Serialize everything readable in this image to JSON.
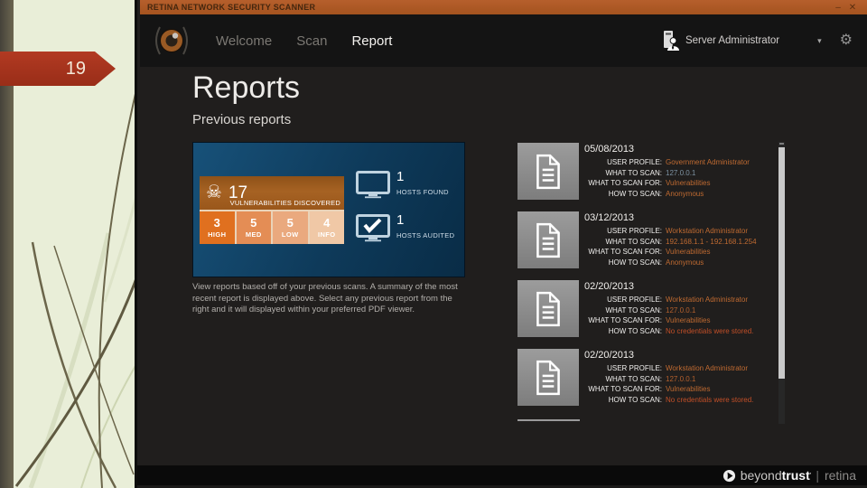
{
  "slide": {
    "number": "19"
  },
  "window": {
    "title": "RETINA NETWORK SECURITY SCANNER",
    "minimize": "–",
    "close": "✕"
  },
  "nav": {
    "tabs": [
      {
        "label": "Welcome",
        "active": false
      },
      {
        "label": "Scan",
        "active": false
      },
      {
        "label": "Report",
        "active": true
      }
    ],
    "user_label": "Server Administrator",
    "caret": "▾",
    "gear": "⚙"
  },
  "page": {
    "title": "Reports",
    "subtitle": "Previous reports",
    "description": "View reports based off of your previous scans.  A summary of the most recent report is displayed above.  Select any previous report from the right and it will displayed within your preferred PDF viewer."
  },
  "summary": {
    "skull": "☠",
    "vuln_count": "17",
    "vuln_label": "VULNERABILITIES DISCOVERED",
    "severities": [
      {
        "count": "3",
        "label": "HIGH",
        "bg": "#e0701f"
      },
      {
        "count": "5",
        "label": "MED",
        "bg": "#e48d55"
      },
      {
        "count": "5",
        "label": "LOW",
        "bg": "#eaa97e"
      },
      {
        "count": "4",
        "label": "INFO",
        "bg": "#f0c8a6"
      }
    ],
    "hosts_found": {
      "count": "1",
      "label": "HOSTS FOUND"
    },
    "hosts_audited": {
      "count": "1",
      "label": "HOSTS AUDITED"
    }
  },
  "reports": {
    "labels": [
      "USER PROFILE:",
      "WHAT TO SCAN:",
      "WHAT TO SCAN FOR:",
      "HOW TO SCAN:"
    ],
    "items": [
      {
        "date": "05/08/2013",
        "values": [
          {
            "text": "Government Administrator",
            "color": "#bf6a31"
          },
          {
            "text": "127.0.0.1",
            "color": "#7d92a2"
          },
          {
            "text": "Vulnerabilities",
            "color": "#bf6a31"
          },
          {
            "text": "Anonymous",
            "color": "#bf6a31"
          }
        ]
      },
      {
        "date": "03/12/2013",
        "values": [
          {
            "text": "Workstation Administrator",
            "color": "#bf6a31"
          },
          {
            "text": "192.168.1.1 - 192.168.1.254",
            "color": "#bf6a31"
          },
          {
            "text": "Vulnerabilities",
            "color": "#bf6a31"
          },
          {
            "text": "Anonymous",
            "color": "#bf6a31"
          }
        ]
      },
      {
        "date": "02/20/2013",
        "values": [
          {
            "text": "Workstation Administrator",
            "color": "#bf6a31"
          },
          {
            "text": "127.0.0.1",
            "color": "#b4602d"
          },
          {
            "text": "Vulnerabilities",
            "color": "#bf6a31"
          },
          {
            "text": "No credentials were stored.",
            "color": "#c14f28"
          }
        ]
      },
      {
        "date": "02/20/2013",
        "values": [
          {
            "text": "Workstation Administrator",
            "color": "#bf6a31"
          },
          {
            "text": "127.0.0.1",
            "color": "#b4602d"
          },
          {
            "text": "Vulnerabilities",
            "color": "#bf6a31"
          },
          {
            "text": "No credentials were stored.",
            "color": "#c14f28"
          }
        ]
      }
    ]
  },
  "footer": {
    "brand_light": "beyond",
    "brand_bold": "trust",
    "trademark": "’",
    "separator": "|",
    "product": "retina"
  },
  "colors": {
    "titlebar": "#ad5a27",
    "banner": "#a5331e",
    "tile_blue": "#0e3a5a",
    "accent_orange": "#bf6a31"
  }
}
